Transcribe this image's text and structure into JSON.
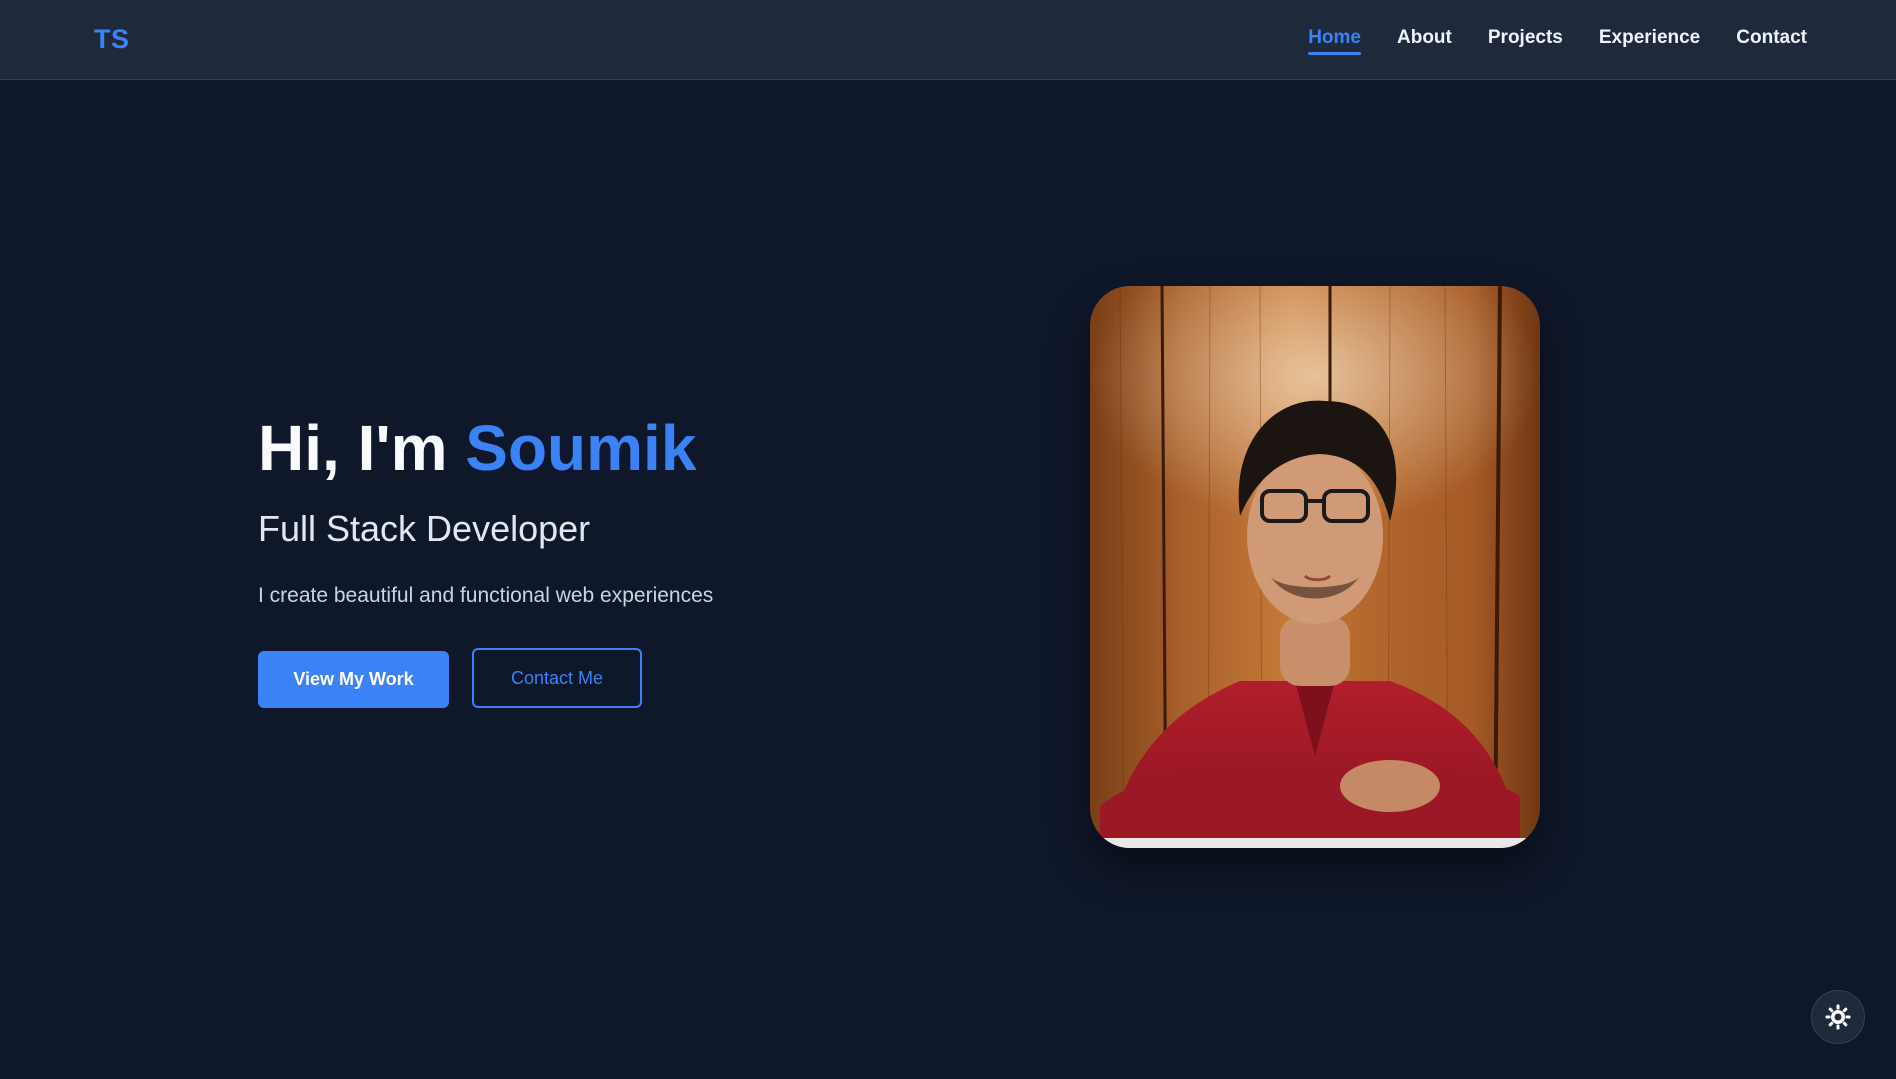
{
  "navbar": {
    "logo": "TS",
    "links": [
      {
        "label": "Home",
        "active": true
      },
      {
        "label": "About",
        "active": false
      },
      {
        "label": "Projects",
        "active": false
      },
      {
        "label": "Experience",
        "active": false
      },
      {
        "label": "Contact",
        "active": false
      }
    ]
  },
  "hero": {
    "greeting": "Hi, I'm ",
    "name": "Soumik",
    "subtitle": "Full Stack Developer",
    "description": "I create beautiful and functional web experiences",
    "primary_button": "View My Work",
    "secondary_button": "Contact Me"
  },
  "profile_image": {
    "icon": "profile-photo"
  },
  "theme_toggle": {
    "icon": "sun-icon"
  },
  "colors": {
    "background": "#0f172a",
    "navbar": "#1e293b",
    "accent": "#3b82f6",
    "text": "#f1f5f9"
  }
}
